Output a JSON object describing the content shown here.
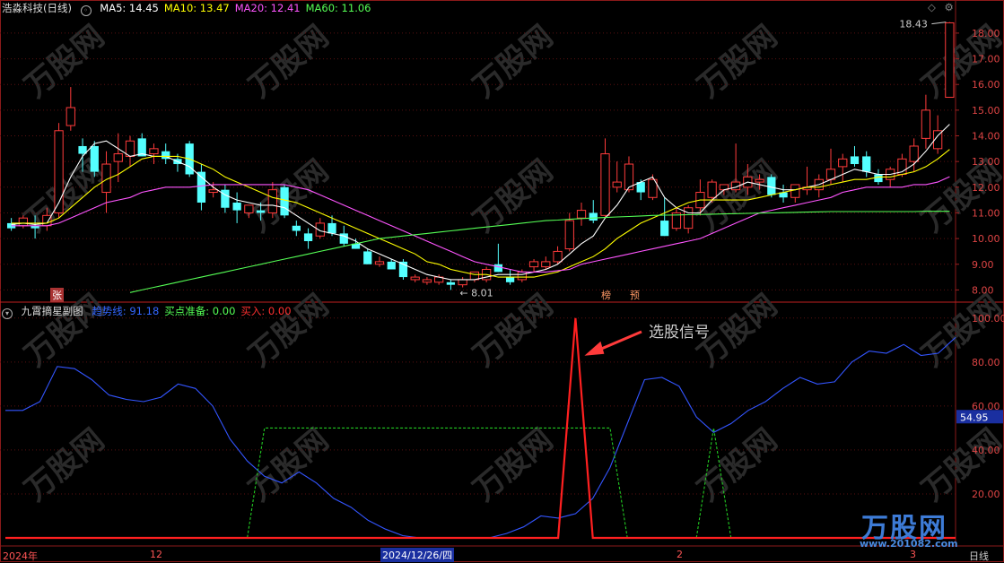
{
  "main_header": {
    "stock_name": "浩淼科技(日线)",
    "indicators": [
      {
        "label": "MA5: 14.45",
        "color": "#ffffff"
      },
      {
        "label": "MA10: 13.47",
        "color": "#ffff00"
      },
      {
        "label": "MA20: 12.41",
        "color": "#ff55ff"
      },
      {
        "label": "MA60: 11.06",
        "color": "#55ff55"
      }
    ]
  },
  "sub_header": {
    "name": "九霄摘星副图",
    "indicators": [
      {
        "label": "趋势线: 91.18",
        "color": "#3366ff"
      },
      {
        "label": "买点准备: 0.00",
        "color": "#55ff55"
      },
      {
        "label": "买入: 0.00",
        "color": "#ff3030"
      }
    ]
  },
  "annotation": {
    "text": "选股信号",
    "color": "#ff3b3b"
  },
  "markers": {
    "zhang": "张",
    "bang": "榜",
    "yu": "预"
  },
  "time_axis": {
    "labels": [
      "2024年",
      "12",
      "2024/12/26/四",
      "2",
      "3"
    ],
    "period": "日线"
  },
  "watermark": {
    "brand": "万股网",
    "site": "www.201082.com"
  },
  "chart_data": [
    {
      "type": "candlestick",
      "title": "浩淼科技(日线)",
      "ylim": [
        7.7,
        18.8
      ],
      "yticks": [
        8.0,
        9.0,
        10.0,
        11.0,
        12.0,
        13.0,
        14.0,
        15.0,
        16.0,
        17.0,
        18.0
      ],
      "grid": true,
      "high_label": "18.43",
      "low_label": "8.01",
      "candles": [
        {
          "o": 10.6,
          "h": 10.8,
          "l": 10.3,
          "c": 10.4
        },
        {
          "o": 10.5,
          "h": 10.9,
          "l": 10.4,
          "c": 10.8
        },
        {
          "o": 10.5,
          "h": 10.9,
          "l": 10.0,
          "c": 10.4
        },
        {
          "o": 10.5,
          "h": 11.2,
          "l": 10.3,
          "c": 10.9
        },
        {
          "o": 11.0,
          "h": 14.5,
          "l": 10.8,
          "c": 14.2
        },
        {
          "o": 14.4,
          "h": 15.9,
          "l": 14.2,
          "c": 15.1
        },
        {
          "o": 13.6,
          "h": 13.9,
          "l": 12.6,
          "c": 13.3
        },
        {
          "o": 13.6,
          "h": 13.8,
          "l": 12.4,
          "c": 12.6
        },
        {
          "o": 11.8,
          "h": 13.4,
          "l": 11.0,
          "c": 12.9
        },
        {
          "o": 13.0,
          "h": 14.1,
          "l": 12.2,
          "c": 13.3
        },
        {
          "o": 13.2,
          "h": 14.0,
          "l": 12.8,
          "c": 13.8
        },
        {
          "o": 13.9,
          "h": 14.1,
          "l": 13.2,
          "c": 13.2
        },
        {
          "o": 13.3,
          "h": 13.7,
          "l": 12.9,
          "c": 13.5
        },
        {
          "o": 13.4,
          "h": 13.7,
          "l": 12.9,
          "c": 13.1
        },
        {
          "o": 13.1,
          "h": 13.3,
          "l": 12.6,
          "c": 12.9
        },
        {
          "o": 13.7,
          "h": 13.8,
          "l": 12.4,
          "c": 12.5
        },
        {
          "o": 12.6,
          "h": 12.9,
          "l": 11.1,
          "c": 11.4
        },
        {
          "o": 11.8,
          "h": 12.2,
          "l": 11.6,
          "c": 11.9
        },
        {
          "o": 11.9,
          "h": 12.1,
          "l": 11.0,
          "c": 11.2
        },
        {
          "o": 11.4,
          "h": 11.8,
          "l": 10.6,
          "c": 11.1
        },
        {
          "o": 11.0,
          "h": 11.3,
          "l": 10.8,
          "c": 11.3
        },
        {
          "o": 11.1,
          "h": 11.4,
          "l": 10.7,
          "c": 11.0
        },
        {
          "o": 11.0,
          "h": 12.2,
          "l": 10.8,
          "c": 11.9
        },
        {
          "o": 12.0,
          "h": 12.1,
          "l": 10.8,
          "c": 10.9
        },
        {
          "o": 10.5,
          "h": 10.7,
          "l": 10.1,
          "c": 10.3
        },
        {
          "o": 10.2,
          "h": 10.4,
          "l": 9.6,
          "c": 9.9
        },
        {
          "o": 10.1,
          "h": 10.8,
          "l": 10.0,
          "c": 10.6
        },
        {
          "o": 10.6,
          "h": 10.9,
          "l": 10.1,
          "c": 10.2
        },
        {
          "o": 10.2,
          "h": 10.5,
          "l": 9.7,
          "c": 9.8
        },
        {
          "o": 9.8,
          "h": 10.0,
          "l": 9.6,
          "c": 9.6
        },
        {
          "o": 9.5,
          "h": 9.6,
          "l": 9.0,
          "c": 9.0
        },
        {
          "o": 9.0,
          "h": 9.3,
          "l": 8.9,
          "c": 9.1
        },
        {
          "o": 9.1,
          "h": 9.2,
          "l": 8.8,
          "c": 8.8
        },
        {
          "o": 9.1,
          "h": 9.2,
          "l": 8.4,
          "c": 8.5
        },
        {
          "o": 8.4,
          "h": 8.6,
          "l": 8.3,
          "c": 8.5
        },
        {
          "o": 8.3,
          "h": 8.5,
          "l": 8.2,
          "c": 8.4
        },
        {
          "o": 8.3,
          "h": 8.6,
          "l": 8.2,
          "c": 8.5
        },
        {
          "o": 8.3,
          "h": 8.4,
          "l": 8.0,
          "c": 8.2
        },
        {
          "o": 8.2,
          "h": 8.5,
          "l": 8.1,
          "c": 8.4
        },
        {
          "o": 8.4,
          "h": 8.7,
          "l": 8.3,
          "c": 8.7
        },
        {
          "o": 8.4,
          "h": 8.9,
          "l": 8.3,
          "c": 8.8
        },
        {
          "o": 9.0,
          "h": 9.8,
          "l": 8.7,
          "c": 8.7
        },
        {
          "o": 8.5,
          "h": 8.8,
          "l": 8.2,
          "c": 8.3
        },
        {
          "o": 8.4,
          "h": 8.8,
          "l": 8.3,
          "c": 8.7
        },
        {
          "o": 8.9,
          "h": 9.2,
          "l": 8.7,
          "c": 9.1
        },
        {
          "o": 8.9,
          "h": 9.3,
          "l": 8.8,
          "c": 9.1
        },
        {
          "o": 9.1,
          "h": 9.7,
          "l": 9.0,
          "c": 9.5
        },
        {
          "o": 9.6,
          "h": 11.0,
          "l": 9.5,
          "c": 10.7
        },
        {
          "o": 10.8,
          "h": 11.4,
          "l": 10.5,
          "c": 11.1
        },
        {
          "o": 11.0,
          "h": 11.5,
          "l": 10.6,
          "c": 10.7
        },
        {
          "o": 10.9,
          "h": 13.9,
          "l": 10.8,
          "c": 13.3
        },
        {
          "o": 12.0,
          "h": 13.0,
          "l": 11.8,
          "c": 12.2
        },
        {
          "o": 11.9,
          "h": 13.2,
          "l": 11.8,
          "c": 12.9
        },
        {
          "o": 12.2,
          "h": 12.3,
          "l": 11.5,
          "c": 11.8
        },
        {
          "o": 11.6,
          "h": 12.5,
          "l": 11.5,
          "c": 12.3
        },
        {
          "o": 10.7,
          "h": 11.6,
          "l": 10.1,
          "c": 10.1
        },
        {
          "o": 10.4,
          "h": 11.2,
          "l": 10.3,
          "c": 11.0
        },
        {
          "o": 10.4,
          "h": 11.3,
          "l": 10.2,
          "c": 11.2
        },
        {
          "o": 11.2,
          "h": 12.3,
          "l": 10.9,
          "c": 11.8
        },
        {
          "o": 11.6,
          "h": 12.3,
          "l": 11.4,
          "c": 12.2
        },
        {
          "o": 11.9,
          "h": 12.1,
          "l": 11.7,
          "c": 12.1
        },
        {
          "o": 11.9,
          "h": 13.7,
          "l": 11.8,
          "c": 12.2
        },
        {
          "o": 12.0,
          "h": 12.9,
          "l": 11.7,
          "c": 12.4
        },
        {
          "o": 12.2,
          "h": 12.5,
          "l": 11.9,
          "c": 12.3
        },
        {
          "o": 12.4,
          "h": 12.5,
          "l": 11.6,
          "c": 11.7
        },
        {
          "o": 11.8,
          "h": 12.1,
          "l": 11.4,
          "c": 11.6
        },
        {
          "o": 11.6,
          "h": 12.1,
          "l": 11.4,
          "c": 12.1
        },
        {
          "o": 11.9,
          "h": 12.8,
          "l": 11.7,
          "c": 12.0
        },
        {
          "o": 11.9,
          "h": 12.5,
          "l": 11.6,
          "c": 12.3
        },
        {
          "o": 12.3,
          "h": 13.5,
          "l": 12.1,
          "c": 12.7
        },
        {
          "o": 12.8,
          "h": 13.3,
          "l": 12.2,
          "c": 13.1
        },
        {
          "o": 13.2,
          "h": 13.6,
          "l": 12.8,
          "c": 12.9
        },
        {
          "o": 13.2,
          "h": 13.4,
          "l": 12.4,
          "c": 12.6
        },
        {
          "o": 12.5,
          "h": 12.7,
          "l": 12.1,
          "c": 12.2
        },
        {
          "o": 12.3,
          "h": 12.8,
          "l": 12.0,
          "c": 12.7
        },
        {
          "o": 12.5,
          "h": 13.3,
          "l": 12.4,
          "c": 13.1
        },
        {
          "o": 13.0,
          "h": 13.9,
          "l": 12.6,
          "c": 13.6
        },
        {
          "o": 13.9,
          "h": 15.6,
          "l": 13.5,
          "c": 15.0
        },
        {
          "o": 13.5,
          "h": 14.8,
          "l": 13.3,
          "c": 14.2
        },
        {
          "o": 15.5,
          "h": 18.43,
          "l": 15.5,
          "c": 18.4
        }
      ],
      "series": [
        {
          "name": "MA5",
          "color": "#ffffff",
          "values": [
            10.55,
            10.6,
            10.55,
            10.6,
            11.4,
            12.4,
            13.2,
            13.7,
            13.8,
            13.5,
            13.2,
            13.3,
            13.2,
            13.2,
            13.0,
            12.8,
            12.4,
            12.0,
            11.7,
            11.5,
            11.4,
            11.3,
            11.3,
            11.2,
            10.9,
            10.6,
            10.3,
            10.2,
            10.1,
            9.9,
            9.6,
            9.4,
            9.2,
            9.0,
            8.8,
            8.6,
            8.5,
            8.4,
            8.4,
            8.4,
            8.5,
            8.6,
            8.6,
            8.6,
            8.7,
            8.8,
            9.0,
            9.4,
            9.8,
            10.1,
            10.8,
            11.3,
            12.0,
            12.2,
            12.4,
            11.6,
            11.2,
            11.0,
            11.0,
            11.5,
            11.9,
            12.0,
            12.2,
            12.1,
            12.0,
            11.9,
            11.9,
            12.0,
            12.1,
            12.3,
            12.5,
            12.7,
            12.6,
            12.5,
            12.5,
            12.6,
            12.9,
            13.4,
            14.0,
            14.45
          ]
        },
        {
          "name": "MA10",
          "color": "#ffff00",
          "values": [
            10.6,
            10.6,
            10.6,
            10.6,
            10.8,
            11.2,
            11.6,
            12.0,
            12.3,
            12.5,
            12.8,
            13.1,
            13.2,
            13.2,
            13.2,
            13.1,
            12.9,
            12.7,
            12.4,
            12.2,
            12.0,
            11.8,
            11.6,
            11.5,
            11.4,
            11.2,
            11.0,
            10.8,
            10.6,
            10.4,
            10.2,
            10.0,
            9.8,
            9.6,
            9.4,
            9.1,
            9.0,
            8.8,
            8.7,
            8.6,
            8.6,
            8.5,
            8.5,
            8.5,
            8.5,
            8.6,
            8.7,
            8.9,
            9.1,
            9.3,
            9.6,
            10.0,
            10.3,
            10.6,
            10.8,
            11.0,
            11.2,
            11.4,
            11.5,
            11.5,
            11.5,
            11.5,
            11.5,
            11.6,
            11.7,
            11.8,
            11.9,
            12.0,
            12.0,
            12.1,
            12.2,
            12.3,
            12.3,
            12.4,
            12.4,
            12.5,
            12.6,
            12.8,
            13.1,
            13.47
          ]
        },
        {
          "name": "MA20",
          "color": "#ff55ff",
          "values": [
            10.5,
            10.5,
            10.5,
            10.5,
            10.6,
            10.8,
            11.0,
            11.2,
            11.4,
            11.5,
            11.6,
            11.8,
            11.9,
            12.0,
            12.0,
            12.0,
            12.05,
            12.1,
            12.1,
            12.1,
            12.1,
            12.1,
            12.1,
            12.1,
            12.0,
            11.9,
            11.7,
            11.5,
            11.3,
            11.1,
            10.9,
            10.7,
            10.5,
            10.3,
            10.1,
            9.9,
            9.7,
            9.5,
            9.3,
            9.1,
            9.0,
            8.9,
            8.8,
            8.7,
            8.7,
            8.7,
            8.75,
            8.8,
            9.0,
            9.1,
            9.2,
            9.3,
            9.4,
            9.5,
            9.6,
            9.7,
            9.8,
            9.9,
            10.0,
            10.2,
            10.4,
            10.6,
            10.8,
            11.0,
            11.1,
            11.2,
            11.3,
            11.4,
            11.5,
            11.6,
            11.8,
            11.9,
            12.0,
            12.0,
            12.0,
            12.0,
            12.1,
            12.1,
            12.2,
            12.41
          ]
        },
        {
          "name": "MA60",
          "color": "#55ff55",
          "values": [
            null,
            null,
            null,
            null,
            null,
            null,
            null,
            null,
            null,
            null,
            7.9,
            8.0,
            8.1,
            8.2,
            8.3,
            8.4,
            8.5,
            8.6,
            8.7,
            8.8,
            8.9,
            9.0,
            9.1,
            9.2,
            9.3,
            9.4,
            9.5,
            9.6,
            9.7,
            9.8,
            9.9,
            10.0,
            10.05,
            10.1,
            10.15,
            10.2,
            10.25,
            10.3,
            10.35,
            10.4,
            10.45,
            10.5,
            10.55,
            10.6,
            10.65,
            10.7,
            10.72,
            10.75,
            10.78,
            10.8,
            10.82,
            10.84,
            10.86,
            10.88,
            10.9,
            10.91,
            10.92,
            10.93,
            10.94,
            10.95,
            10.96,
            10.97,
            10.98,
            10.99,
            11.0,
            11.01,
            11.02,
            11.03,
            11.04,
            11.05,
            11.05,
            11.05,
            11.05,
            11.05,
            11.05,
            11.05,
            11.05,
            11.06,
            11.06,
            11.06
          ]
        }
      ]
    },
    {
      "type": "line",
      "title": "九霄摘星副图",
      "ylim": [
        0,
        104
      ],
      "yticks": [
        20.0,
        40.0,
        60.0,
        80.0,
        100.0
      ],
      "grid": true,
      "current_value_label": "54.95",
      "series": [
        {
          "name": "趋势线",
          "color": "#3355ff",
          "values": [
            58,
            58,
            62,
            78,
            77,
            72,
            65,
            63,
            62,
            64,
            70,
            68,
            60,
            45,
            35,
            28,
            25,
            30,
            25,
            18,
            14,
            8,
            4,
            1,
            0,
            0,
            0,
            0,
            0,
            2,
            5,
            10,
            9,
            11,
            18,
            32,
            52,
            72,
            73,
            69,
            55,
            48,
            52,
            58,
            62,
            68,
            73,
            70,
            71,
            80,
            85,
            84,
            88,
            83,
            84,
            91.18
          ]
        },
        {
          "name": "买点准备",
          "color": "#22cc22",
          "dashed": true,
          "values": [
            0,
            0,
            0,
            0,
            0,
            0,
            0,
            0,
            0,
            0,
            0,
            0,
            0,
            0,
            0,
            50,
            50,
            50,
            50,
            50,
            50,
            50,
            50,
            50,
            50,
            50,
            50,
            50,
            50,
            50,
            50,
            50,
            50,
            50,
            50,
            50,
            0,
            0,
            0,
            0,
            0,
            50,
            0,
            0,
            0,
            0,
            0,
            0,
            0,
            0,
            0,
            0,
            0,
            0,
            0,
            0
          ]
        },
        {
          "name": "买入",
          "color": "#ff2020",
          "values": [
            0,
            0,
            0,
            0,
            0,
            0,
            0,
            0,
            0,
            0,
            0,
            0,
            0,
            0,
            0,
            0,
            0,
            0,
            0,
            0,
            0,
            0,
            0,
            0,
            0,
            0,
            0,
            0,
            0,
            0,
            0,
            0,
            0,
            100,
            0,
            0,
            0,
            0,
            0,
            0,
            0,
            0,
            0,
            0,
            0,
            0,
            0,
            0,
            0,
            0,
            0,
            0,
            0,
            0,
            0,
            0
          ]
        }
      ]
    }
  ]
}
